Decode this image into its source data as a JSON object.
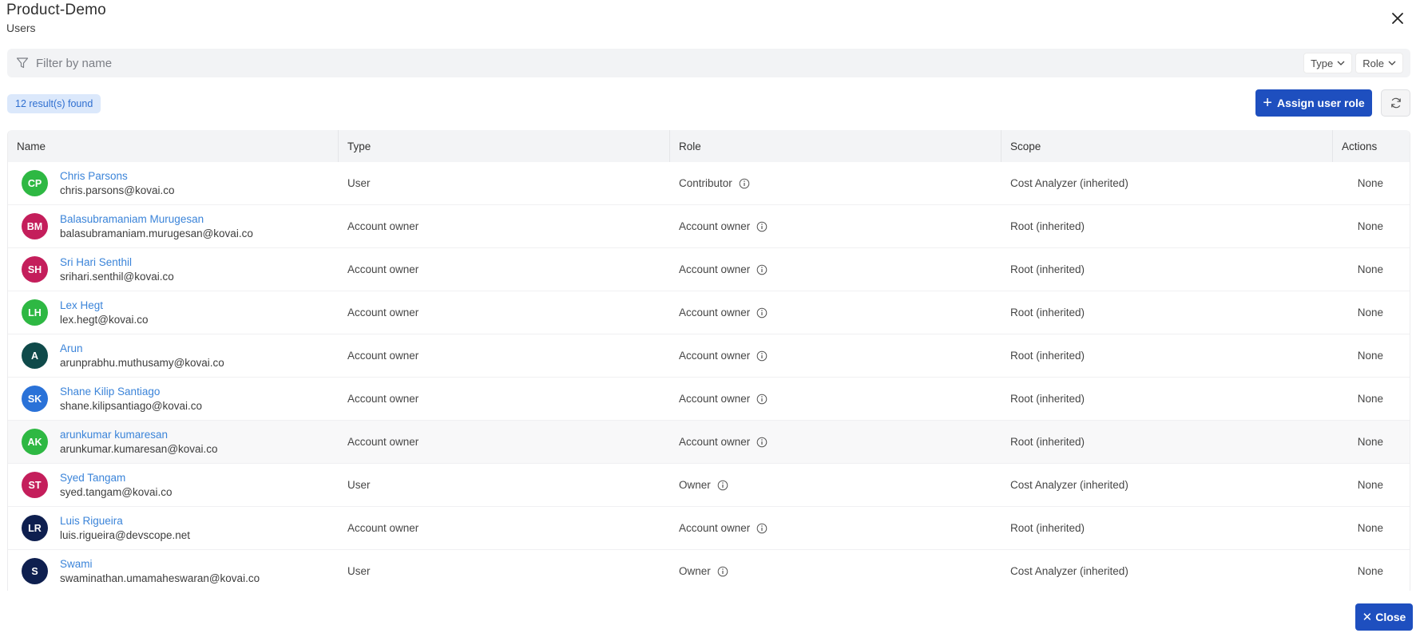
{
  "header": {
    "title": "Product-Demo",
    "subtitle": "Users"
  },
  "filter": {
    "placeholder": "Filter by name",
    "value": "",
    "dropdowns": [
      {
        "label": "Type"
      },
      {
        "label": "Role"
      }
    ]
  },
  "results_badge": "12 result(s) found",
  "toolbar": {
    "assign_label": "Assign user role",
    "assign_icon": "plus-icon",
    "refresh_icon": "refresh-icon"
  },
  "colors": {
    "accent": "#1e4fbf",
    "link": "#3b84d9",
    "badge_bg": "#dbe8fb",
    "badge_text": "#2f6fd0"
  },
  "table": {
    "columns": [
      "Name",
      "Type",
      "Role",
      "Scope",
      "Actions"
    ],
    "rows": [
      {
        "initials": "CP",
        "avatar_color": "#2eb843",
        "name": "Chris Parsons",
        "email": "chris.parsons@kovai.co",
        "type": "User",
        "role": "Contributor",
        "scope": "Cost Analyzer (inherited)",
        "actions": "None"
      },
      {
        "initials": "BM",
        "avatar_color": "#c41e5b",
        "name": "Balasubramaniam Murugesan",
        "email": "balasubramaniam.murugesan@kovai.co",
        "type": "Account owner",
        "role": "Account owner",
        "scope": "Root (inherited)",
        "actions": "None"
      },
      {
        "initials": "SH",
        "avatar_color": "#c41e5b",
        "name": "Sri Hari Senthil",
        "email": "srihari.senthil@kovai.co",
        "type": "Account owner",
        "role": "Account owner",
        "scope": "Root (inherited)",
        "actions": "None"
      },
      {
        "initials": "LH",
        "avatar_color": "#2eb843",
        "name": "Lex Hegt",
        "email": "lex.hegt@kovai.co",
        "type": "Account owner",
        "role": "Account owner",
        "scope": "Root (inherited)",
        "actions": "None"
      },
      {
        "initials": "A",
        "avatar_color": "#0f4a4a",
        "name": "Arun",
        "email": "arunprabhu.muthusamy@kovai.co",
        "type": "Account owner",
        "role": "Account owner",
        "scope": "Root (inherited)",
        "actions": "None"
      },
      {
        "initials": "SK",
        "avatar_color": "#2a72d8",
        "name": "Shane Kilip Santiago",
        "email": "shane.kilipsantiago@kovai.co",
        "type": "Account owner",
        "role": "Account owner",
        "scope": "Root (inherited)",
        "actions": "None"
      },
      {
        "initials": "AK",
        "avatar_color": "#2eb843",
        "name": "arunkumar kumaresan",
        "email": "arunkumar.kumaresan@kovai.co",
        "type": "Account owner",
        "role": "Account owner",
        "scope": "Root (inherited)",
        "actions": "None",
        "hovered": true
      },
      {
        "initials": "ST",
        "avatar_color": "#c41e5b",
        "name": "Syed Tangam",
        "email": "syed.tangam@kovai.co",
        "type": "User",
        "role": "Owner",
        "scope": "Cost Analyzer (inherited)",
        "actions": "None"
      },
      {
        "initials": "LR",
        "avatar_color": "#0e1f4f",
        "name": "Luis Rigueira",
        "email": "luis.rigueira@devscope.net",
        "type": "Account owner",
        "role": "Account owner",
        "scope": "Root (inherited)",
        "actions": "None"
      },
      {
        "initials": "S",
        "avatar_color": "#0e1f4f",
        "name": "Swami",
        "email": "swaminathan.umamaheswaran@kovai.co",
        "type": "User",
        "role": "Owner",
        "scope": "Cost Analyzer (inherited)",
        "actions": "None"
      }
    ]
  },
  "footer": {
    "close_label": "Close"
  }
}
